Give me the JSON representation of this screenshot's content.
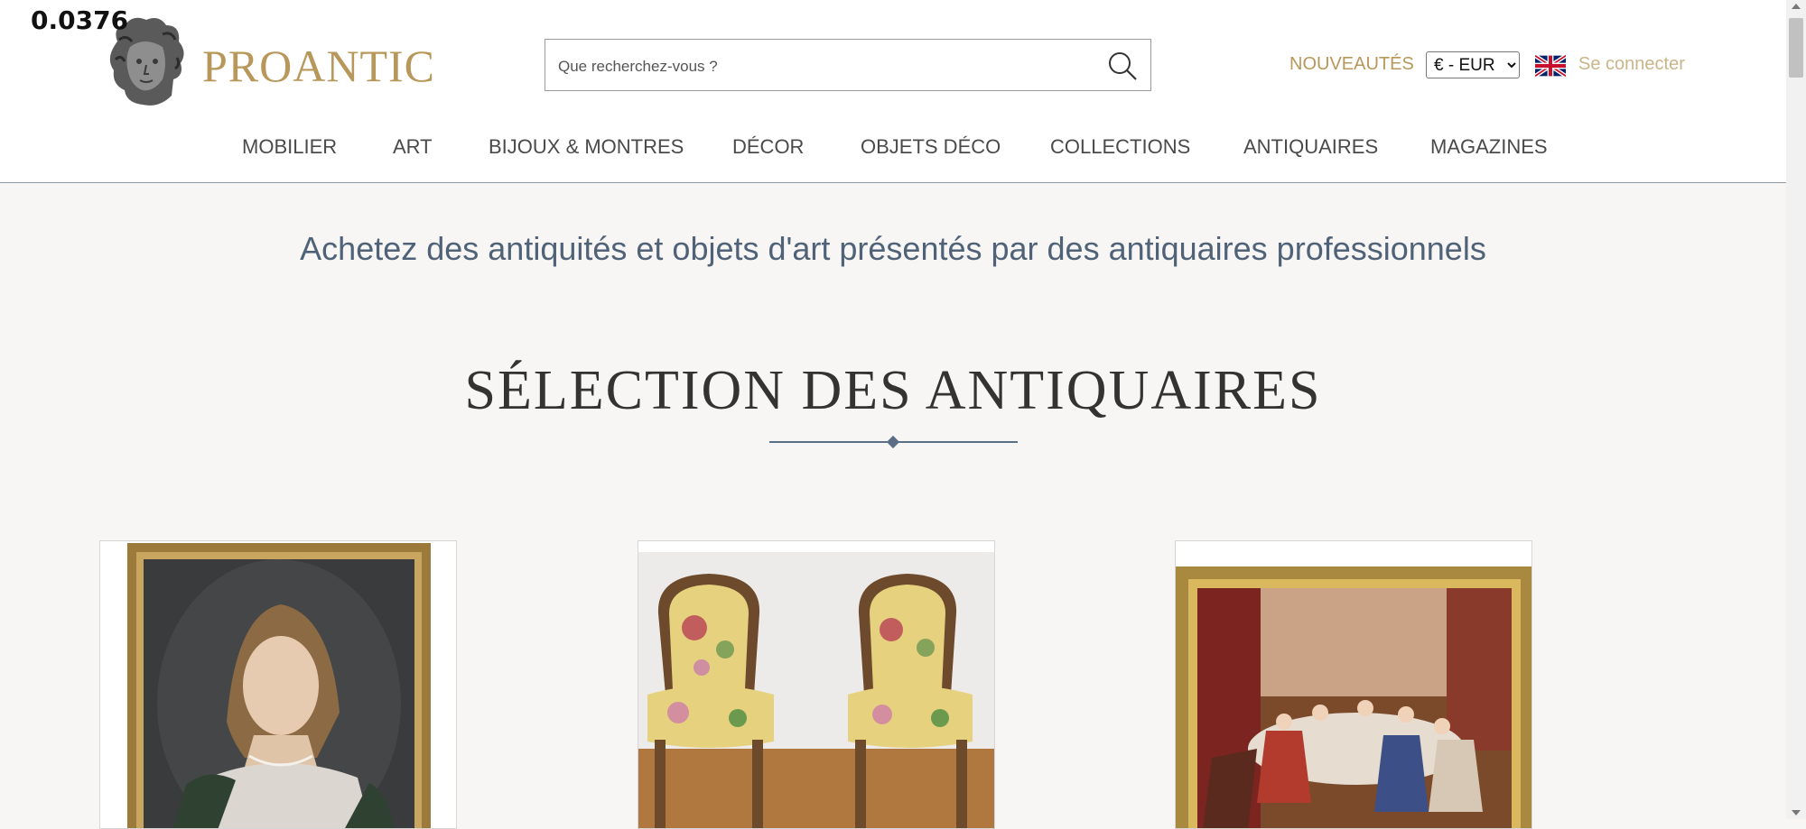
{
  "overlay": {
    "value": "0.0376"
  },
  "header": {
    "logo_text": "PROANTIC",
    "search": {
      "placeholder": "Que recherchez-vous ?"
    },
    "new_label": "NOUVEAUTÉS",
    "currency": {
      "selected": "€ - EUR"
    },
    "login_label": "Se connecter",
    "flag_icon": "uk-flag-icon",
    "search_icon": "search-icon"
  },
  "nav": {
    "items": [
      {
        "label": "MOBILIER"
      },
      {
        "label": "ART"
      },
      {
        "label": "BIJOUX & MONTRES"
      },
      {
        "label": "DÉCOR"
      },
      {
        "label": "OBJETS DÉCO"
      },
      {
        "label": "COLLECTIONS"
      },
      {
        "label": "ANTIQUAIRES"
      },
      {
        "label": "MAGAZINES"
      }
    ]
  },
  "main": {
    "tagline": "Achetez des antiquités et objets d'art présentés par des antiquaires professionnels",
    "section_title": "SÉLECTION DES ANTIQUAIRES"
  },
  "colors": {
    "brand_gold": "#b8975a",
    "slate_blue": "#4f6278",
    "background": "#f7f6f4"
  }
}
